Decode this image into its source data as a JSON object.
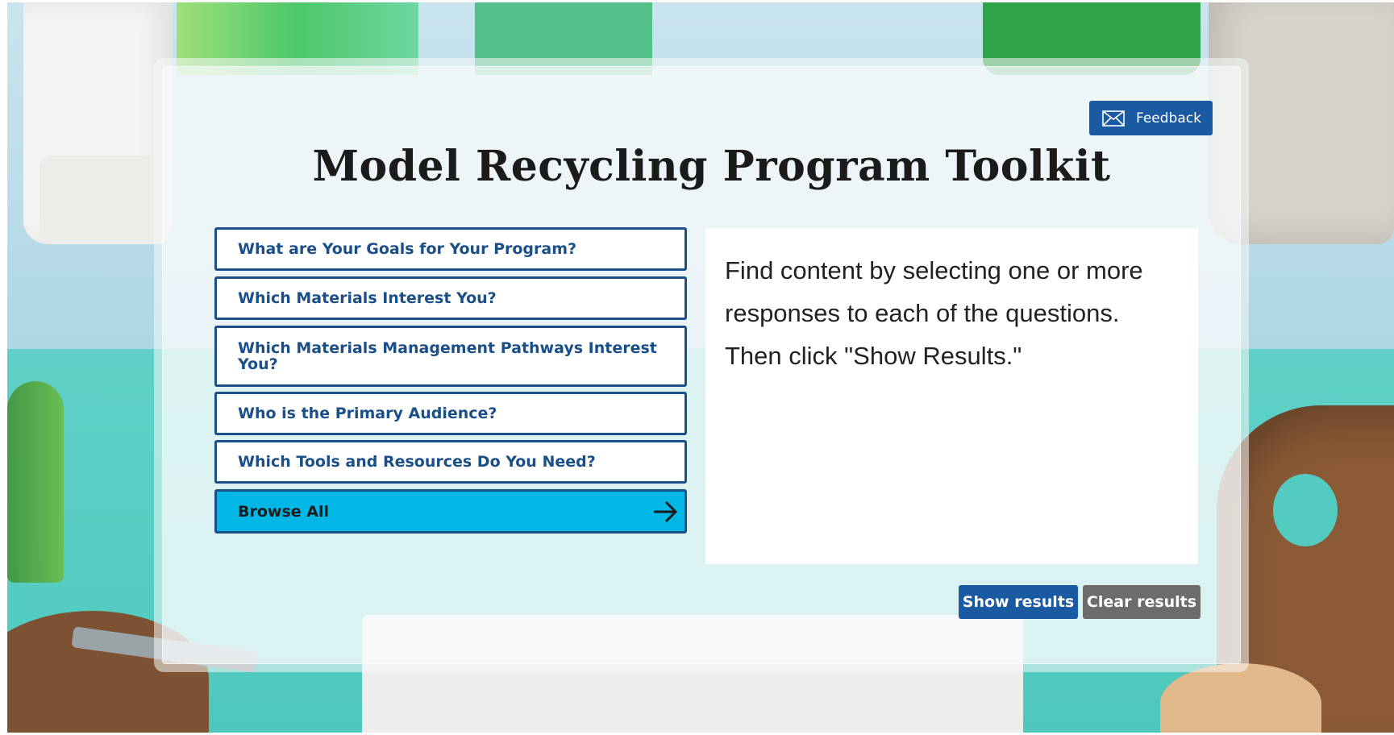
{
  "header": {
    "title": "Model Recycling Program Toolkit",
    "feedback_label": "Feedback",
    "feedback_icon": "envelope-icon"
  },
  "questions": [
    {
      "label": "What are Your Goals for Your Program?"
    },
    {
      "label": "Which Materials Interest You?"
    },
    {
      "label": "Which Materials Management Pathways Interest You?"
    },
    {
      "label": "Who is the Primary Audience?"
    },
    {
      "label": "Which Tools and Resources Do You Need?"
    }
  ],
  "browse_all": {
    "label": "Browse All",
    "icon": "arrow-right-icon"
  },
  "instructions": {
    "text": "Find content by selecting one or more responses to each of the questions. Then click \"Show Results.\""
  },
  "actions": {
    "show_results_label": "Show results",
    "clear_results_label": "Clear results"
  },
  "colors": {
    "primary_blue": "#1a5aa3",
    "question_border": "#1a4f8a",
    "browse_all_bg": "#00b7e6",
    "clear_button_bg": "#6c6c6c"
  }
}
